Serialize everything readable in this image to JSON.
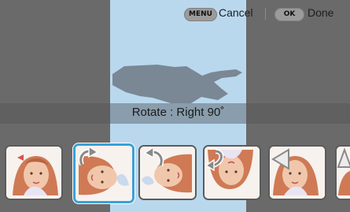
{
  "header": {
    "menu_key": "MENU",
    "cancel_label": "Cancel",
    "ok_key": "OK",
    "done_label": "Done"
  },
  "caption": "Rotate : Right 90˚",
  "thumbnails": [
    {
      "effect": "original",
      "overlay_icon": null
    },
    {
      "effect": "rotate-right-90",
      "overlay_icon": "rotate-right-icon",
      "selected": true
    },
    {
      "effect": "rotate-left-90",
      "overlay_icon": "rotate-left-icon"
    },
    {
      "effect": "rotate-180",
      "overlay_icon": "rotate-180-icon"
    },
    {
      "effect": "flip-horizontal",
      "overlay_icon": "flip-horizontal-icon"
    },
    {
      "effect": "flip-vertical",
      "overlay_icon": "flip-vertical-icon"
    }
  ],
  "colors": {
    "accent": "#3aa0d8",
    "preview_background": "#b9d8ee",
    "dim": "#6a6a6a"
  }
}
